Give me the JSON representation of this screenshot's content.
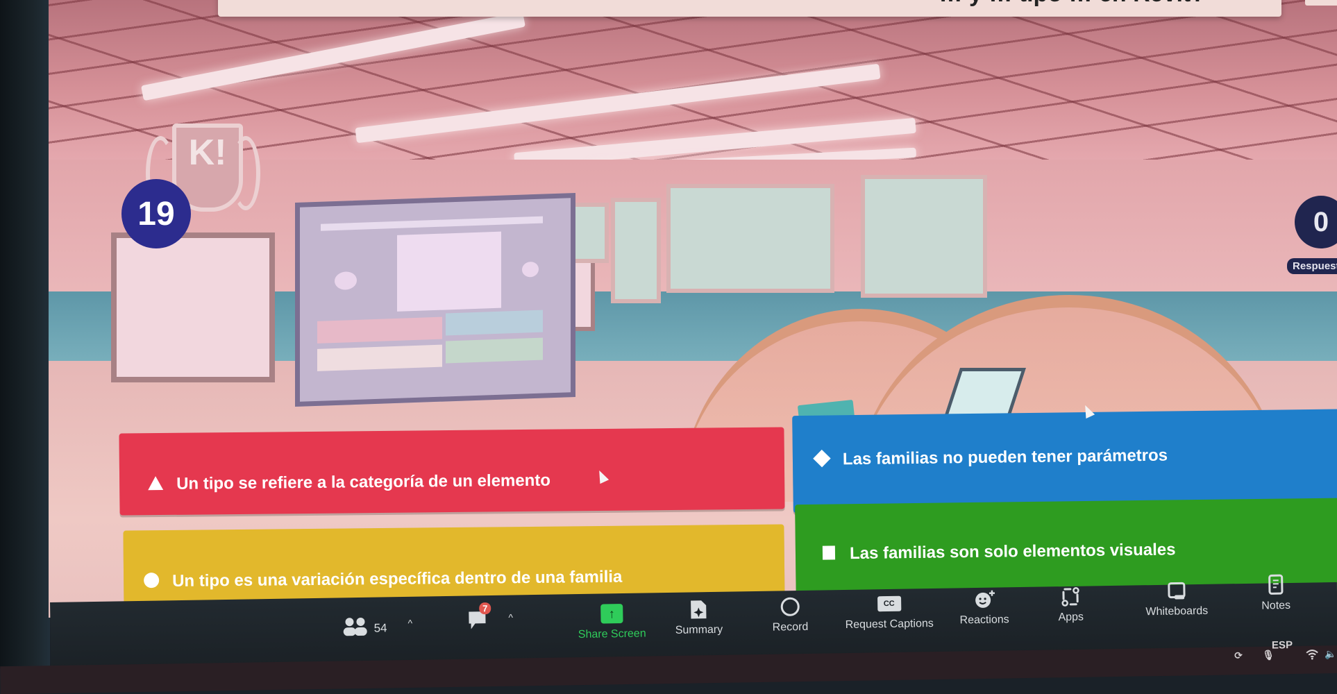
{
  "app": {
    "name": "Kahoot! in Zoom meeting",
    "colors": {
      "red": "#e5384f",
      "blue": "#1f7fcb",
      "yellow": "#e2b82c",
      "green": "#2e9c20",
      "timer_bg": "#2c2c8e",
      "answers_bg": "#20254f",
      "share_green": "#2fcc5a",
      "badge_red": "#e0574f"
    }
  },
  "quiz": {
    "question_partial": "… y … tipo … en Revit?",
    "logo_text": "K!",
    "timer_value": "19",
    "answers_count": "0",
    "answers_label": "Respuestas",
    "answers": [
      {
        "shape": "triangle-icon",
        "color": "red",
        "label": "Un tipo se refiere a la categoría de un elemento"
      },
      {
        "shape": "diamond-icon",
        "color": "blue",
        "label": "Las familias no pueden tener parámetros"
      },
      {
        "shape": "circle-icon",
        "color": "yellow",
        "label": "Un tipo es una variación específica dentro de una familia"
      },
      {
        "shape": "square-icon",
        "color": "green",
        "label": "Las familias son solo elementos visuales"
      }
    ]
  },
  "zoom_toolbar": {
    "participants": {
      "icon": "participants-icon",
      "count": "54"
    },
    "chat": {
      "icon": "chat-icon",
      "badge": "7"
    },
    "share_screen": {
      "icon": "share-screen-icon",
      "label": "Share Screen"
    },
    "summary": {
      "icon": "summary-icon",
      "label": "Summary"
    },
    "record": {
      "icon": "record-icon",
      "label": "Record"
    },
    "captions": {
      "icon": "cc-icon",
      "icon_text": "CC",
      "label": "Request Captions"
    },
    "reactions": {
      "icon": "reactions-icon",
      "label": "Reactions"
    },
    "apps": {
      "icon": "apps-icon",
      "label": "Apps"
    },
    "whiteboards": {
      "icon": "whiteboard-icon",
      "label": "Whiteboards"
    },
    "notes": {
      "icon": "notes-icon",
      "label": "Notes"
    },
    "caret": "^"
  },
  "os_taskbar": {
    "language": "ESP",
    "tray_icons": [
      "refresh-icon",
      "microphone-icon",
      "wifi-icon",
      "speaker-icon"
    ]
  }
}
